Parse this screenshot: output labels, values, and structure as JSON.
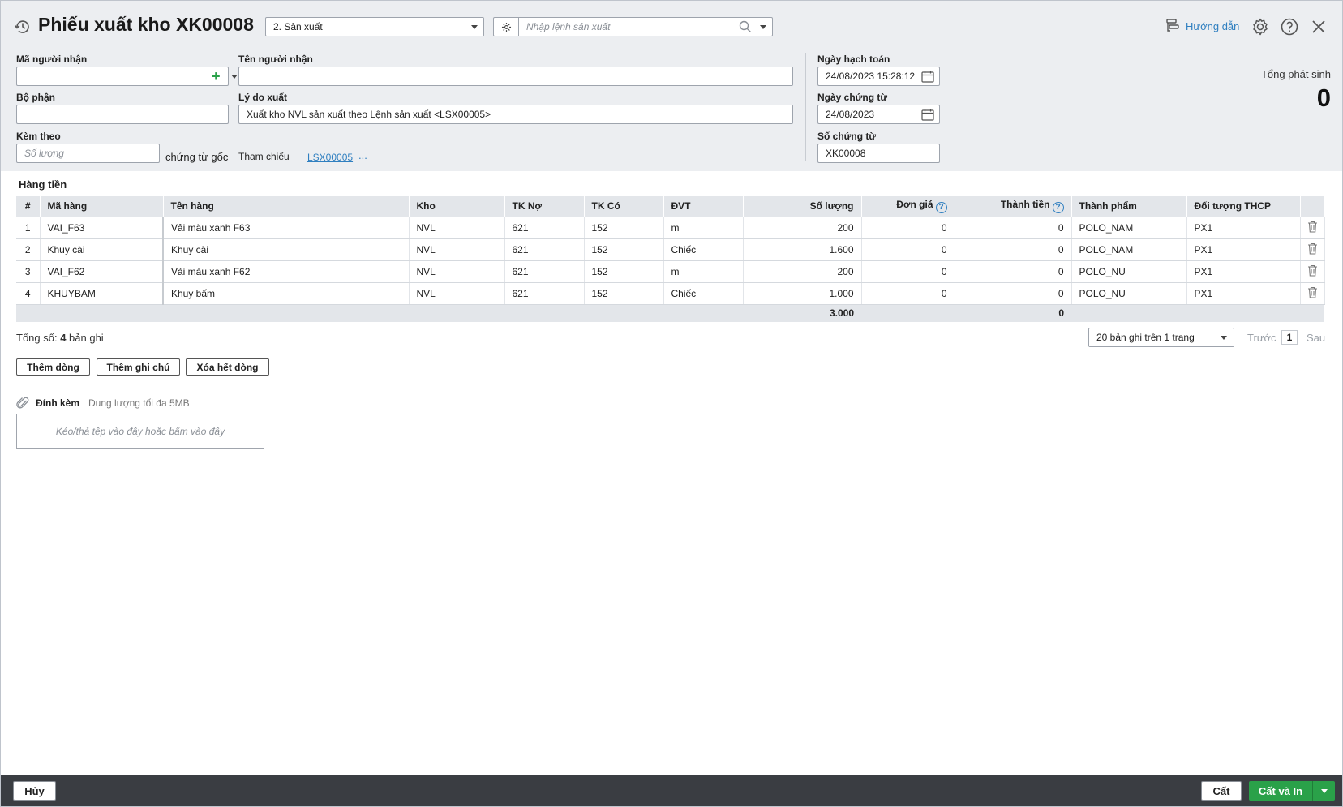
{
  "header": {
    "title": "Phiếu xuất kho XK00008",
    "type_select": "2. Sản xuất",
    "command_placeholder": "Nhập lệnh sản xuất",
    "guide_label": "Hướng dẫn"
  },
  "form": {
    "recipient_code_label": "Mã người nhận",
    "recipient_code_value": "",
    "recipient_name_label": "Tên người nhận",
    "recipient_name_value": "",
    "department_label": "Bộ phận",
    "department_value": "",
    "reason_label": "Lý do xuất",
    "reason_value": "Xuất kho NVL sản xuất theo Lệnh sản xuất <LSX00005>",
    "attach_label": "Kèm theo",
    "attach_qty_placeholder": "Số lượng",
    "original_docs_label": "chứng từ gốc",
    "reference_label": "Tham chiếu",
    "reference_link": "LSX00005",
    "reference_more": "...",
    "posting_date_label": "Ngày hạch toán",
    "posting_date_value": "24/08/2023 15:28:12",
    "doc_date_label": "Ngày chứng từ",
    "doc_date_value": "24/08/2023",
    "doc_no_label": "Số chứng từ",
    "doc_no_value": "XK00008"
  },
  "totals": {
    "label": "Tổng phát sinh",
    "value": "0"
  },
  "grid": {
    "section_title": "Hàng tiền",
    "columns": [
      "#",
      "Mã hàng",
      "Tên hàng",
      "Kho",
      "TK Nợ",
      "TK Có",
      "ĐVT",
      "Số lượng",
      "Đơn giá",
      "Thành tiền",
      "Thành phẩm",
      "Đối tượng THCP"
    ],
    "rows": [
      {
        "no": "1",
        "code": "VAI_F63",
        "name": "Vải màu xanh F63",
        "warehouse": "NVL",
        "debit": "621",
        "credit": "152",
        "unit": "m",
        "qty": "200",
        "price": "0",
        "amount": "0",
        "product": "POLO_NAM",
        "cost_object": "PX1"
      },
      {
        "no": "2",
        "code": "Khuy cài",
        "name": "Khuy cài",
        "warehouse": "NVL",
        "debit": "621",
        "credit": "152",
        "unit": "Chiếc",
        "qty": "1.600",
        "price": "0",
        "amount": "0",
        "product": "POLO_NAM",
        "cost_object": "PX1"
      },
      {
        "no": "3",
        "code": "VAI_F62",
        "name": "Vải màu xanh F62",
        "warehouse": "NVL",
        "debit": "621",
        "credit": "152",
        "unit": "m",
        "qty": "200",
        "price": "0",
        "amount": "0",
        "product": "POLO_NU",
        "cost_object": "PX1"
      },
      {
        "no": "4",
        "code": "KHUYBAM",
        "name": "Khuy bấm",
        "warehouse": "NVL",
        "debit": "621",
        "credit": "152",
        "unit": "Chiếc",
        "qty": "1.000",
        "price": "0",
        "amount": "0",
        "product": "POLO_NU",
        "cost_object": "PX1"
      }
    ],
    "footer_qty": "3.000",
    "footer_amount": "0"
  },
  "pagination": {
    "total_prefix": "Tổng số: ",
    "total_count": "4",
    "total_suffix": " bản ghi",
    "page_size": "20 bản ghi trên 1 trang",
    "prev": "Trước",
    "page": "1",
    "next": "Sau"
  },
  "actions": {
    "add_row": "Thêm dòng",
    "add_note": "Thêm ghi chú",
    "delete_all": "Xóa hết dòng"
  },
  "attachments": {
    "label": "Đính kèm",
    "note": "Dung lượng tối đa 5MB",
    "dropzone": "Kéo/thả tệp vào đây hoặc bấm vào đây"
  },
  "footer": {
    "cancel": "Hủy",
    "save": "Cất",
    "save_print": "Cất và In"
  },
  "colors": {
    "accent_green": "#2aa149",
    "link_blue": "#2f7fc0",
    "footer_bg": "#3a3d42",
    "header_bg": "#eceef1"
  }
}
